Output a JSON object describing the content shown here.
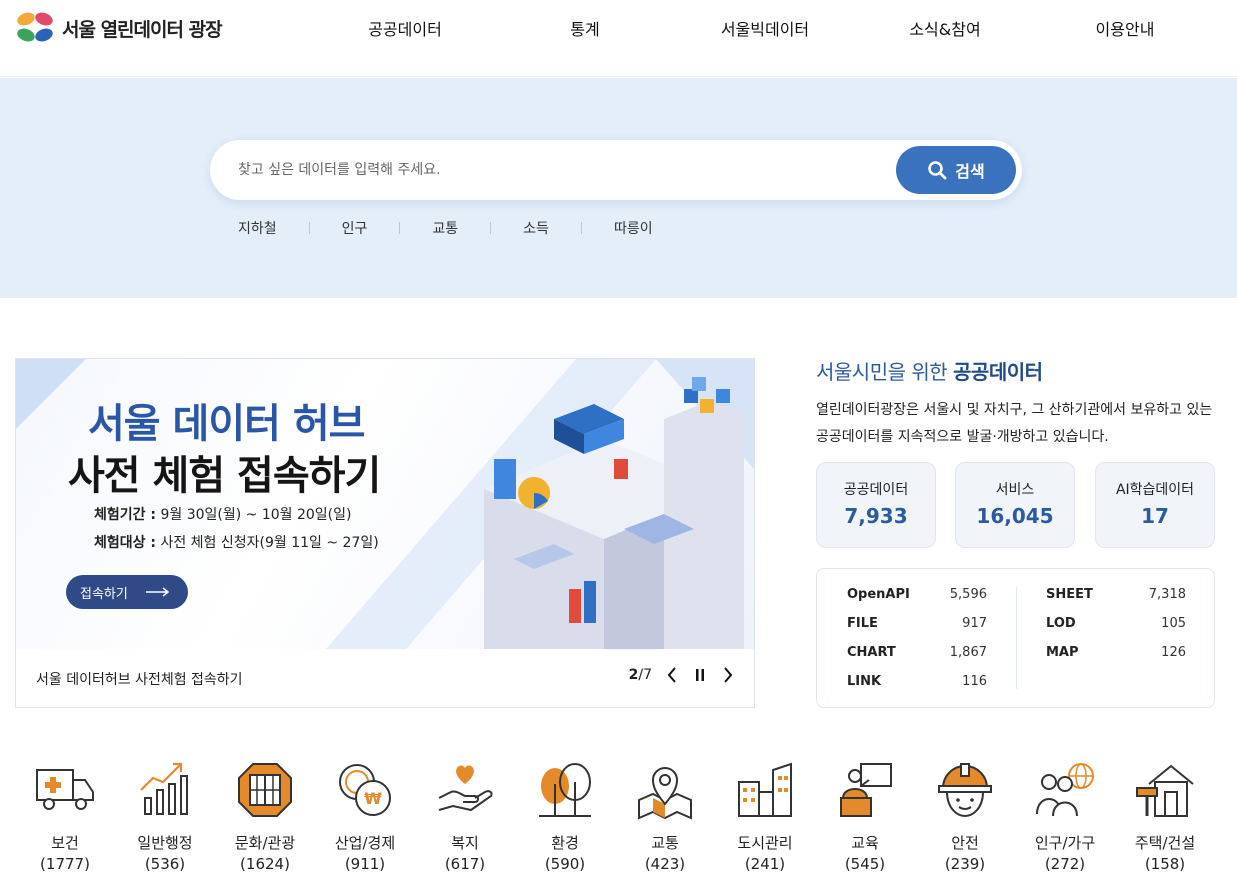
{
  "header": {
    "logo_text": "서울 열린데이터 광장",
    "nav": [
      "공공데이터",
      "통계",
      "서울빅데이터",
      "소식&참여",
      "이용안내"
    ]
  },
  "search": {
    "placeholder": "찾고 싶은 데이터를 입력해 주세요.",
    "button_label": "검색",
    "keywords": [
      "지하철",
      "인구",
      "교통",
      "소득",
      "따릉이"
    ]
  },
  "banner": {
    "title_line1": "서울 데이터 허브",
    "title_line2": "사전 체험 접속하기",
    "period_label": "체험기간 :",
    "period_value": "9월 30일(월) ~ 10월 20일(일)",
    "target_label": "체험대상 :",
    "target_value": "사전 체험 신청자(9월 11일 ~ 27일)",
    "cta_label": "접속하기",
    "caption": "서울 데이터허브 사전체험 접속하기",
    "pager_current": "2",
    "pager_total": "/7"
  },
  "panel": {
    "title_prefix": "서울시민을 위한",
    "title_highlight": "공공데이터",
    "description": "열린데이터광장은 서울시 및 자치구, 그 산하기관에서 보유하고 있는 공공데이터를 지속적으로 발굴·개방하고 있습니다.",
    "stats": [
      {
        "label": "공공데이터",
        "value": "7,933"
      },
      {
        "label": "서비스",
        "value": "16,045"
      },
      {
        "label": "AI학습데이터",
        "value": "17"
      }
    ],
    "formats_left": [
      {
        "name": "OpenAPI",
        "count": "5,596"
      },
      {
        "name": "FILE",
        "count": "917"
      },
      {
        "name": "CHART",
        "count": "1,867"
      },
      {
        "name": "LINK",
        "count": "116"
      }
    ],
    "formats_right": [
      {
        "name": "SHEET",
        "count": "7,318"
      },
      {
        "name": "LOD",
        "count": "105"
      },
      {
        "name": "MAP",
        "count": "126"
      }
    ]
  },
  "categories": [
    {
      "label": "보건",
      "count": "(1777)",
      "icon": "ambulance-icon"
    },
    {
      "label": "일반행정",
      "count": "(536)",
      "icon": "bar-chart-icon"
    },
    {
      "label": "문화/관광",
      "count": "(1624)",
      "icon": "window-icon"
    },
    {
      "label": "산업/경제",
      "count": "(911)",
      "icon": "coins-icon"
    },
    {
      "label": "복지",
      "count": "(617)",
      "icon": "heart-hand-icon"
    },
    {
      "label": "환경",
      "count": "(590)",
      "icon": "trees-icon"
    },
    {
      "label": "교통",
      "count": "(423)",
      "icon": "map-pin-icon"
    },
    {
      "label": "도시관리",
      "count": "(241)",
      "icon": "buildings-icon"
    },
    {
      "label": "교육",
      "count": "(545)",
      "icon": "teacher-icon"
    },
    {
      "label": "안전",
      "count": "(239)",
      "icon": "helmet-icon"
    },
    {
      "label": "인구/가구",
      "count": "(272)",
      "icon": "people-globe-icon"
    },
    {
      "label": "주택/건설",
      "count": "(158)",
      "icon": "house-tools-icon"
    }
  ],
  "colors": {
    "brand_blue": "#3a72bd",
    "accent_orange": "#e58a2a",
    "search_band": "#e3eef9"
  }
}
